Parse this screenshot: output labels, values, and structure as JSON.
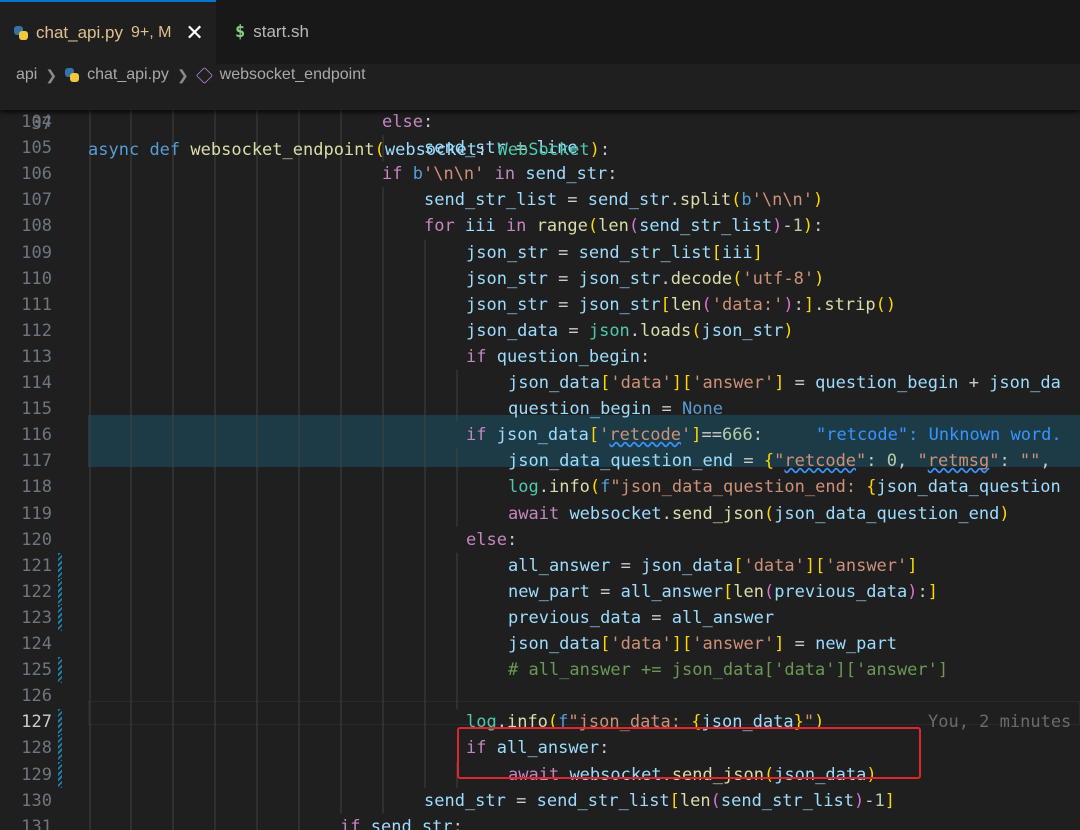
{
  "tabs": [
    {
      "name": "chat_api.py",
      "status": "9+, M",
      "close": "✕"
    },
    {
      "name": "start.sh"
    }
  ],
  "breadcrumb": [
    "api",
    "chat_api.py",
    "websocket_endpoint"
  ],
  "sticky": {
    "ln": "37",
    "text": "async def websocket_endpoint(websocket: WebSocket):"
  },
  "lines": [
    {
      "ln": "104",
      "text": "else:"
    },
    {
      "ln": "105",
      "text": "send_str = line"
    },
    {
      "ln": "106",
      "text": "if b'\\n\\n' in send_str:"
    },
    {
      "ln": "107",
      "text": "send_str_list = send_str.split(b'\\n\\n')"
    },
    {
      "ln": "108",
      "text": "for iii in range(len(send_str_list)-1):"
    },
    {
      "ln": "109",
      "text": "json_str = send_str_list[iii]"
    },
    {
      "ln": "110",
      "text": "json_str = json_str.decode('utf-8')"
    },
    {
      "ln": "111",
      "text": "json_str = json_str[len('data:'):].strip()"
    },
    {
      "ln": "112",
      "text": "json_data = json.loads(json_str)"
    },
    {
      "ln": "113",
      "text": "if question_begin:"
    },
    {
      "ln": "114",
      "text": "json_data['data']['answer'] = question_begin + json_da"
    },
    {
      "ln": "115",
      "text": "question_begin = None"
    },
    {
      "ln": "116",
      "text": "if json_data['retcode']==666:",
      "hint": "\"retcode\": Unknown word."
    },
    {
      "ln": "117",
      "text": "json_data_question_end = {\"retcode\": 0, \"retmsg\": \"\","
    },
    {
      "ln": "118",
      "text": "log.info(f\"json_data_question_end: {json_data_question"
    },
    {
      "ln": "119",
      "text": "await websocket.send_json(json_data_question_end)"
    },
    {
      "ln": "120",
      "text": "else:"
    },
    {
      "ln": "121",
      "text": "all_answer = json_data['data']['answer']"
    },
    {
      "ln": "122",
      "text": "new_part = all_answer[len(previous_data):]"
    },
    {
      "ln": "123",
      "text": "previous_data = all_answer"
    },
    {
      "ln": "124",
      "text": "json_data['data']['answer'] = new_part"
    },
    {
      "ln": "125",
      "text": "# all_answer += json_data['data']['answer']"
    },
    {
      "ln": "126",
      "text": ""
    },
    {
      "ln": "127",
      "text": "log.info(f\"json_data: {json_data}\")",
      "blame": "You, 2 minutes"
    },
    {
      "ln": "128",
      "text": "if all_answer:"
    },
    {
      "ln": "129",
      "text": "await websocket.send_json(json_data)"
    },
    {
      "ln": "130",
      "text": "send_str = send_str_list[len(send_str_list)-1]"
    },
    {
      "ln": "131",
      "text": "if send_str:"
    }
  ],
  "colors": {
    "accent": "#0078d4",
    "highlight": "#1d3b47",
    "annotation": "#e0262d"
  }
}
